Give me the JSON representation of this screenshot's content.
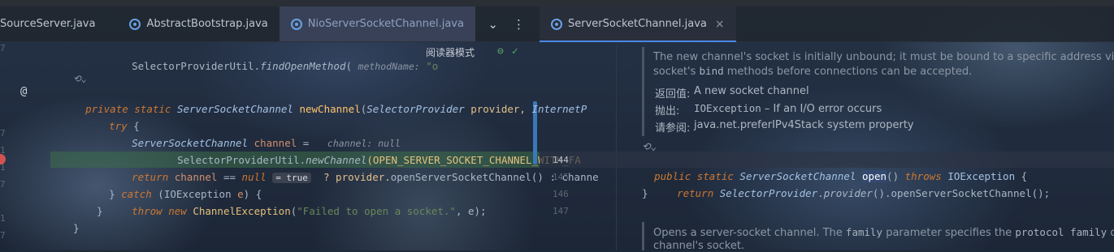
{
  "tabs_left": [
    {
      "label": "SourceServer.java",
      "state": "normal"
    },
    {
      "label": "AbstractBootstrap.java",
      "state": "normal"
    },
    {
      "label": "NioServerSocketChannel.java",
      "state": "selected"
    }
  ],
  "tabs_right": [
    {
      "label": "ServerSocketChannel.java",
      "state": "active",
      "close": "×"
    }
  ],
  "toolbar": {
    "dropdown_icon": "chevron-down-icon",
    "more_icon": "more-vertical-icon"
  },
  "editor_left": {
    "reader_mode": "阅读器模式",
    "line_numbers": [
      "7",
      "7",
      "1",
      "1",
      "7",
      "1",
      "7",
      "1",
      "1",
      "1"
    ],
    "code": {
      "l1_a": "SelectorProviderUtil.",
      "l1_b": "findOpenMethod",
      "l1_c": "( ",
      "l1_hint": "methodName:",
      "l1_d": " \"o",
      "l3_kw1": "private static ",
      "l3_type": "ServerSocketChannel ",
      "l3_fn": "newChannel",
      "l3_rest": "(",
      "l3_ptype": "SelectorProvider",
      "l3_p": " provider, ",
      "l3_ptype2": "InternetP",
      "l4_kw": "try",
      "l4_rest": " {",
      "l5_type": "ServerSocketChannel ",
      "l5_var": "channel",
      "l5_eq": " =   ",
      "l5_hint": "channel: null",
      "l6_a": "SelectorProviderUtil.",
      "l6_b": "newChannel",
      "l6_c": "(OPEN_SERVER_SOCKET_CHANNEL_WITH_FA",
      "l7_kw": "return ",
      "l7_var": "channel",
      "l7_op": " == ",
      "l7_null": "null",
      "l7_hint": "= true",
      "l7_rest": "  ? provider.",
      "l7_fn": "openServerSocketChannel",
      "l7_rest2": "() : channe",
      "l8_a": "} ",
      "l8_kw": "catch",
      "l8_b": " (IOException ",
      "l8_var": "e",
      "l8_c": ") {",
      "l9_kw": "throw new ",
      "l9_fn": "ChannelException",
      "l9_a": "(",
      "l9_str": "\"Failed to open a socket.\"",
      "l9_b": ", e);",
      "l10": "}",
      "l11": "}"
    },
    "fold_hint": "⟲⌄"
  },
  "editor_right": {
    "doc1_line1": "The new channel's socket is initially unbound; it must be bound to a specific address via o",
    "doc1_line2a": "socket's ",
    "doc1_line2_code": "bind",
    "doc1_line2b": " methods before connections can be accepted.",
    "returns_label": "返回值:",
    "returns_value": "A new socket channel",
    "throws_label": "抛出:",
    "throws_code": "IOException",
    "throws_value": " – If an I/O error occurs",
    "see_label": "请参阅:",
    "see_value": "java.net.preferIPv4Stack system property",
    "fold_hint": "⟲⌄",
    "line_numbers": [
      "144",
      "145",
      "146",
      "147"
    ],
    "code": {
      "s1_kw": "public static ",
      "s1_type": "ServerSocketChannel ",
      "s1_fn": "open",
      "s1_paren": "()",
      "s1_kw2": " throws ",
      "s1_ex": "IOException",
      "s1_b": " {",
      "s2_kw": "return ",
      "s2_type": "SelectorProvider",
      "s2_a": ".",
      "s2_fn": "provider",
      "s2_b": "().",
      "s2_fn2": "openServerSocketChannel",
      "s2_c": "();",
      "s3": "}"
    },
    "doc2_line1a": "Opens a server-socket channel. The ",
    "doc2_code1": "family",
    "doc2_line1b": " parameter specifies the ",
    "doc2_code2": "protocol family",
    "doc2_line1c": " of th",
    "doc2_line2": "channel's socket."
  }
}
